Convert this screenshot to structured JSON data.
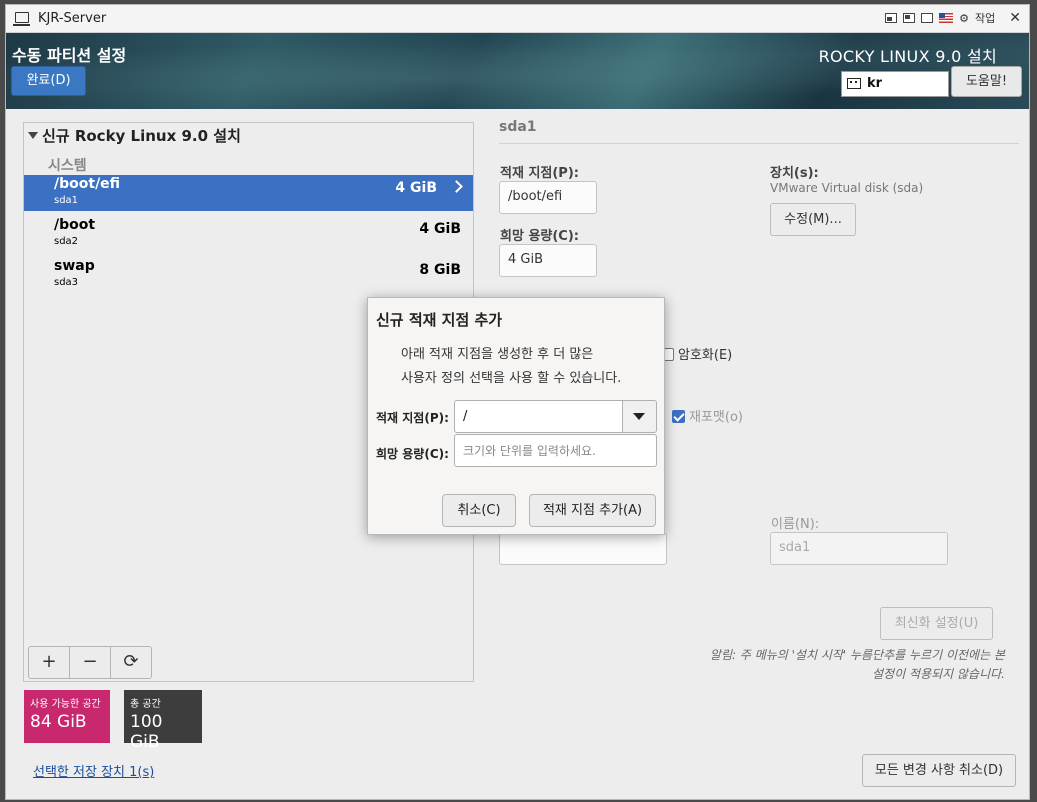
{
  "window": {
    "title": "KJR-Server",
    "controls_label": "작업"
  },
  "header": {
    "page_title": "수동 파티션 설정",
    "done_label": "완료(D)",
    "product": "ROCKY LINUX 9.0 설치",
    "keyboard_layout": "kr",
    "help_label": "도움말!"
  },
  "tree": {
    "heading": "신규 Rocky Linux 9.0 설치",
    "section": "시스템",
    "items": [
      {
        "name": "/boot/efi",
        "device": "sda1",
        "size": "4 GiB",
        "selected": true
      },
      {
        "name": "/boot",
        "device": "sda2",
        "size": "4 GiB",
        "selected": false
      },
      {
        "name": "swap",
        "device": "sda3",
        "size": "8 GiB",
        "selected": false
      }
    ],
    "toolbar": {
      "add": "+",
      "remove": "−",
      "refresh": "⟳"
    }
  },
  "space": {
    "available_label": "사용 가능한 공간",
    "available_value": "84 GiB",
    "total_label": "총 공간",
    "total_value": "100 GiB"
  },
  "storage_link": "선택한 저장 장치 1(s)",
  "detail": {
    "title": "sda1",
    "mount_label": "적재 지점(P):",
    "mount_value": "/boot/efi",
    "capacity_label": "희망 용량(C):",
    "capacity_value": "4 GiB",
    "device_label": "장치(s):",
    "device_value": "VMware Virtual disk (sda)",
    "modify_label": "수정(M)...",
    "encrypt_label": "암호화(E)",
    "reformat_label": "재포맷(o)",
    "name_label": "이름(N):",
    "name_value": "sda1",
    "update_label": "최신화 설정(U)",
    "note_line1": "알림: 주 메뉴의 '설치 시작' 누름단추를 누르기 이전에는 본",
    "note_line2": "설정이 적용되지 않습니다."
  },
  "reset_label": "모든 변경 사항 취소(D)",
  "dialog": {
    "title": "신규 적재 지점 추가",
    "desc_line1": "아래 적재 지점을 생성한 후 더 많은",
    "desc_line2": "사용자 정의 선택을 사용 할 수 있습니다.",
    "mount_label": "적재 지점(P):",
    "mount_value": "/",
    "capacity_label": "희망 용량(C):",
    "capacity_placeholder": "크기와 단위를 입력하세요.",
    "cancel_label": "취소(C)",
    "add_label": "적재 지점 추가(A)"
  }
}
